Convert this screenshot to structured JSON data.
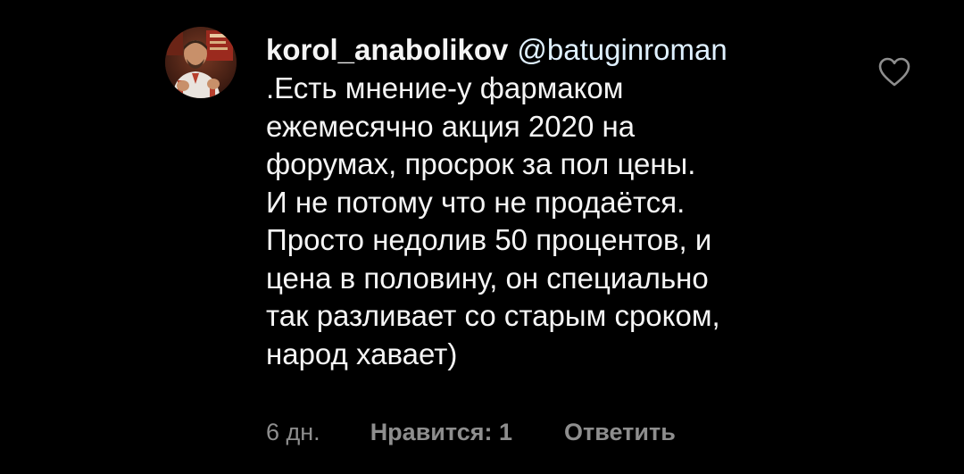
{
  "comment": {
    "username": "korol_anabolikov",
    "mention": "@batuginroman",
    "text": ".Есть мнение-у фармаком\nежемесячно акция 2020 на\nфорумах, просрок за пол цены.\nИ не потому что не продаётся.\nПросто недолив 50 процентов, и\nцена в половину, он специально\nтак разливает со старым сроком,\nнарод хавает)",
    "time": "6 дн.",
    "likes_label": "Нравится: 1",
    "reply_label": "Ответить",
    "like_icon": "heart-outline-icon"
  },
  "colors": {
    "background": "#000000",
    "text": "#f5f5f5",
    "mention": "#e0f1ff",
    "secondary": "#8e8e8e"
  }
}
